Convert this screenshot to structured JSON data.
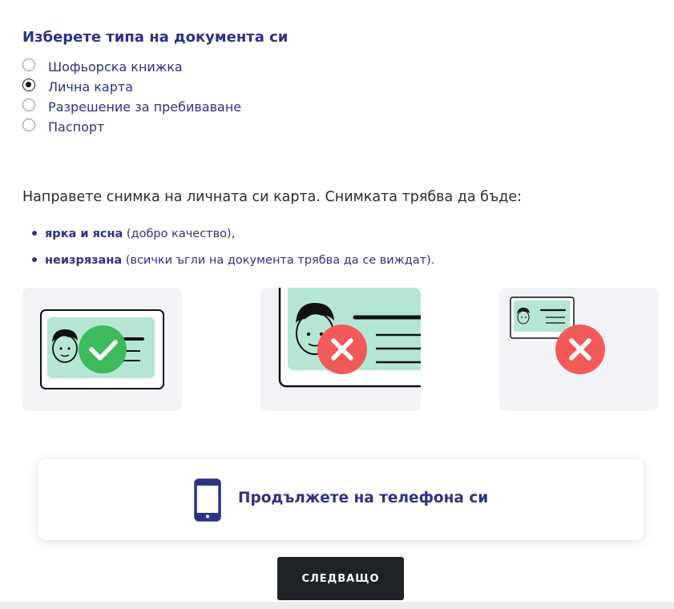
{
  "document_type": {
    "title": "Изберете типа на документа си",
    "options": [
      {
        "label": "Шофьорска книжка",
        "checked": false
      },
      {
        "label": "Лична карта",
        "checked": true
      },
      {
        "label": "Разрешение за пребиваване",
        "checked": false
      },
      {
        "label": "Паспорт",
        "checked": false
      }
    ]
  },
  "instructions": {
    "text": "Направете снимка на личната си карта. Снимката трябва да бъде:",
    "requirements": [
      {
        "bold": "ярка и ясна",
        "rest": " (добро качество),"
      },
      {
        "bold": "неизрязана",
        "rest": " (всички ъгли на документа трябва да се виждат)."
      }
    ]
  },
  "examples": [
    {
      "name": "example-correct",
      "status": "correct",
      "status_icon": "checkmark-icon",
      "status_color": "#3dba5b"
    },
    {
      "name": "example-cropped",
      "status": "wrong",
      "status_icon": "x-icon",
      "status_color": "#f25a5a"
    },
    {
      "name": "example-too-far",
      "status": "wrong",
      "status_icon": "x-icon",
      "status_color": "#f25a5a"
    }
  ],
  "continue_on_phone": {
    "label": "Продължете на телефона си",
    "icon": "smartphone-icon"
  },
  "next_button": {
    "label": "СЛЕДВАЩО"
  },
  "colors": {
    "primary_text": "#2b3383",
    "id_card_fill": "#b5e6d4",
    "card_background": "#f2f3f7",
    "button_background": "#1f2226"
  }
}
